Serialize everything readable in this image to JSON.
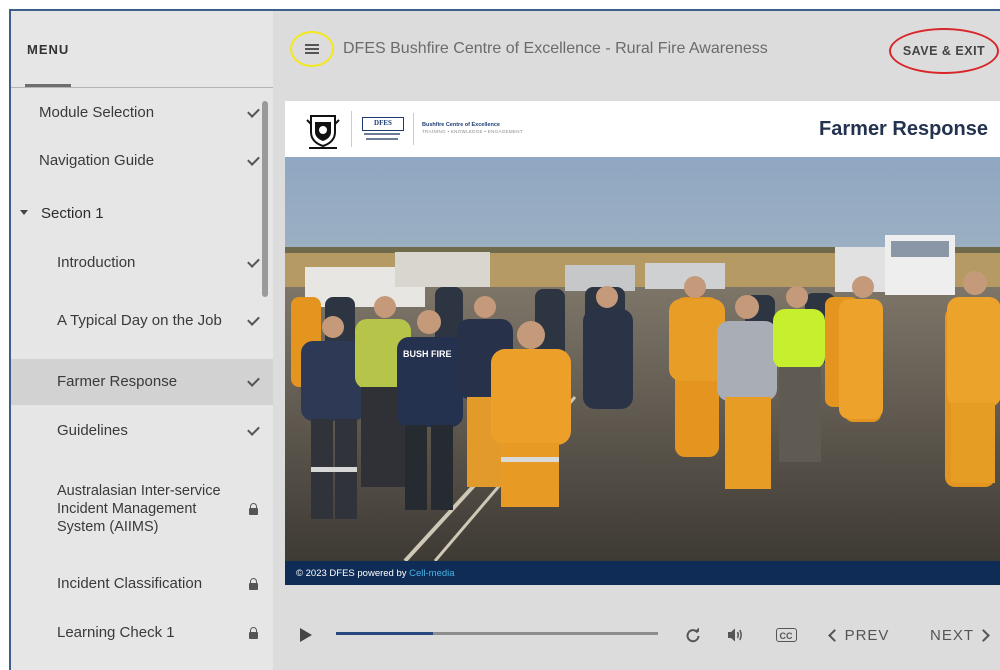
{
  "app": {
    "course_title": "DFES Bushfire Centre of Excellence - Rural Fire Awareness"
  },
  "menu": {
    "title": "MENU",
    "items": [
      {
        "label": "Module Selection",
        "status": "complete"
      },
      {
        "label": "Navigation Guide",
        "status": "complete"
      },
      {
        "label": "Section 1",
        "status": "expanded"
      },
      {
        "label": "Introduction",
        "status": "complete"
      },
      {
        "label": "A Typical Day on the Job",
        "status": "complete"
      },
      {
        "label": "Farmer Response",
        "status": "complete",
        "active": true
      },
      {
        "label": "Guidelines",
        "status": "complete"
      },
      {
        "label": "Australasian Inter-service Incident Management System (AIIMS)",
        "status": "locked"
      },
      {
        "label": "Incident Classification",
        "status": "locked"
      },
      {
        "label": "Learning Check 1",
        "status": "locked"
      }
    ]
  },
  "header": {
    "save_exit_label": "SAVE & EXIT",
    "highlight_colors": {
      "menu": "#f2e81a",
      "save": "#d8262a"
    }
  },
  "slide": {
    "title": "Farmer Response",
    "logos": {
      "dfes": "DFES",
      "centre_name": "Bushfire Centre of Excellence",
      "centre_tagline": "TRAINING • KNOWLEDGE • ENGAGEMENT"
    },
    "photo_text": {
      "shirt": "BUSH FIRE"
    },
    "footer": {
      "copyright": "© 2023 DFES powered by ",
      "brand": "Cell-media"
    },
    "colors": {
      "header_title": "#23334f",
      "footer_bg": "#0f2c57"
    }
  },
  "player": {
    "progress": 0.3,
    "prev_label": "PREV",
    "next_label": "NEXT",
    "cc_label": "CC"
  },
  "icons": [
    "hamburger-icon",
    "check-icon",
    "lock-icon",
    "play-icon",
    "replay-icon",
    "audio-icon",
    "cc-icon",
    "chevron-left-icon",
    "chevron-right-icon",
    "crest-icon"
  ]
}
